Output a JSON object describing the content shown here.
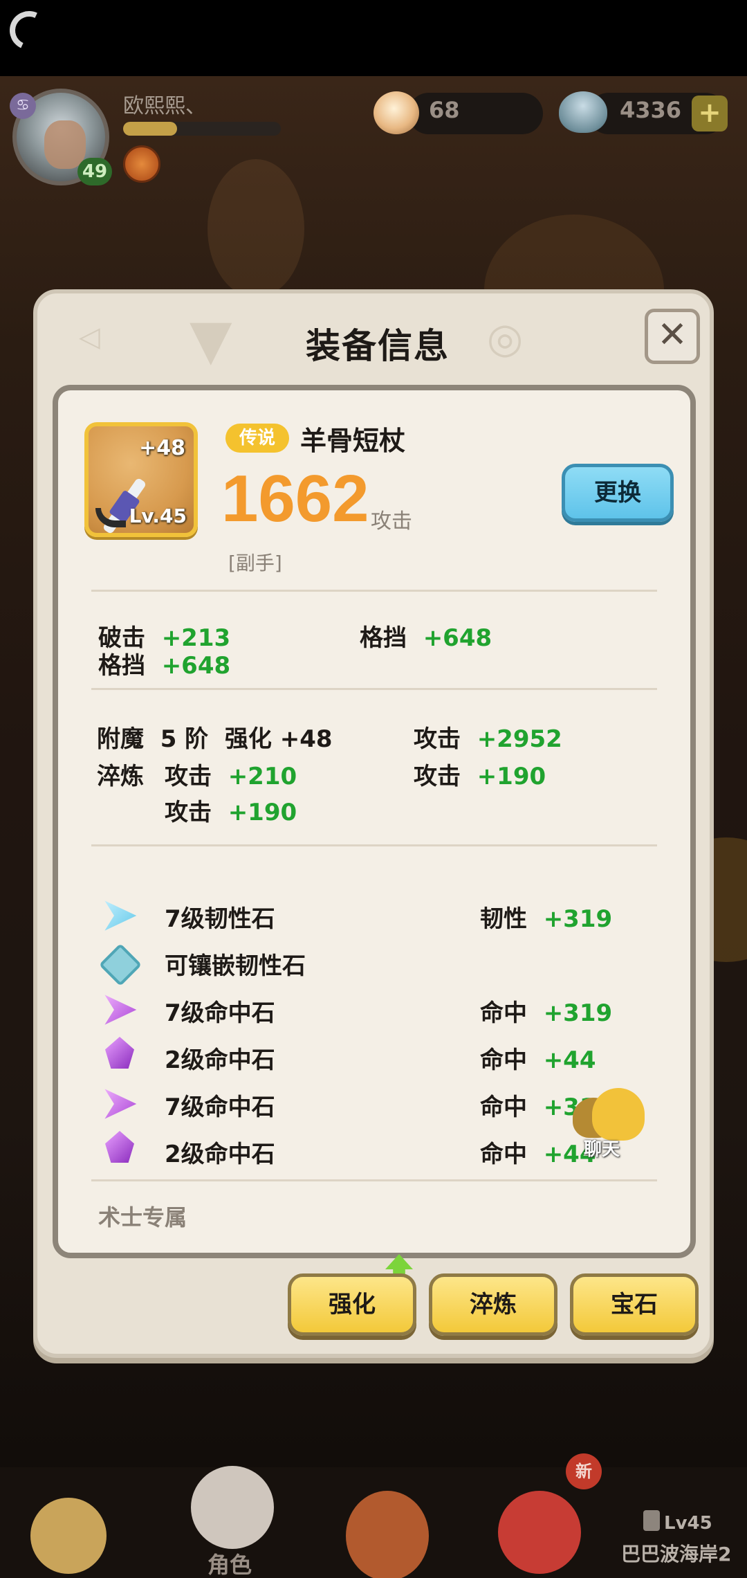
{
  "header": {
    "player_name": "欧熙熙、",
    "player_level": "49",
    "xp_progress": 0.34,
    "pearl_count": "68",
    "shell_count": "4336",
    "add_icon": "plus-icon"
  },
  "dialog": {
    "title": "装备信息",
    "close_icon": "close-icon",
    "item": {
      "enhance_level": "+48",
      "item_level": "Lv.45",
      "rarity": "传说",
      "name": "羊骨短杖",
      "power": "1662",
      "power_label": "攻击",
      "slot": "[副手]",
      "swap_button": "更换"
    },
    "base_stats": [
      {
        "label": "破击",
        "value": "+213"
      },
      {
        "label": "格挡",
        "value": "+648"
      },
      {
        "label": "格挡",
        "value": "+648"
      }
    ],
    "enchant": {
      "label": "附魔",
      "tier": "5 阶",
      "enhance": "强化 +48",
      "stat_label": "攻击",
      "stat_value": "+2952"
    },
    "refine": {
      "label": "淬炼",
      "stats": [
        {
          "label": "攻击",
          "value": "+210"
        },
        {
          "label": "攻击",
          "value": "+190"
        },
        {
          "label": "攻击",
          "value": "+190"
        }
      ]
    },
    "gems": [
      {
        "icon": "toughness-gem-icon",
        "name": "7级韧性石",
        "stat": "韧性",
        "value": "+319"
      },
      {
        "icon": "empty-socket-icon",
        "name": "可镶嵌韧性石",
        "stat": "",
        "value": ""
      },
      {
        "icon": "accuracy-gem-icon",
        "name": "7级命中石",
        "stat": "命中",
        "value": "+319"
      },
      {
        "icon": "accuracy-gem-small-icon",
        "name": "2级命中石",
        "stat": "命中",
        "value": "+44"
      },
      {
        "icon": "accuracy-gem-icon",
        "name": "7级命中石",
        "stat": "命中",
        "value": "+319"
      },
      {
        "icon": "accuracy-gem-small-icon",
        "name": "2级命中石",
        "stat": "命中",
        "value": "+44"
      }
    ],
    "class_note": "术士专属",
    "chat_label": "聊天",
    "actions": {
      "upgrade": "强化",
      "refine": "淬炼",
      "gem": "宝石"
    }
  },
  "nav": {
    "role_label": "角色",
    "new_badge": "新",
    "locked_level": "Lv45",
    "locked_area": "巴巴波海岸2"
  },
  "colors": {
    "accent_orange": "#f39a2d",
    "stat_green": "#20a32f",
    "rarity_gold": "#f4c22e",
    "swap_blue": "#5ec3ea",
    "action_yellow": "#f3c93a"
  }
}
